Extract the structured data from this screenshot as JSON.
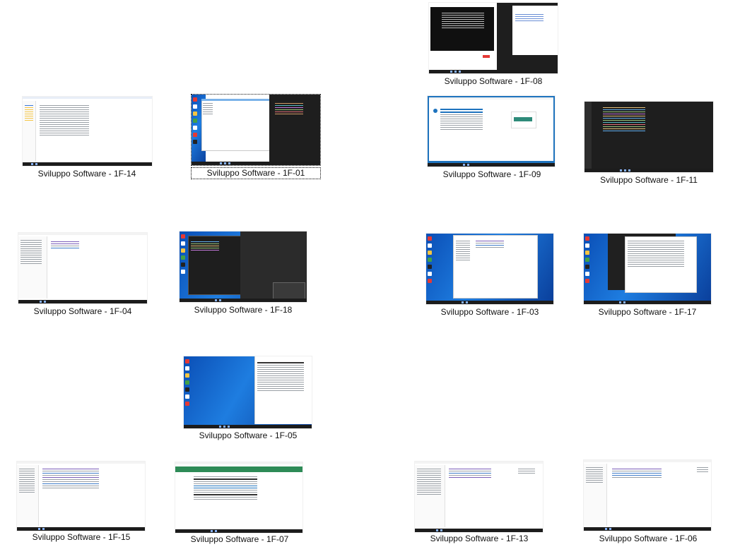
{
  "window": {
    "title": "Sviluppo Software"
  },
  "thumbnails": [
    {
      "id": "1F-08",
      "label": "Sviluppo Software - 1F-08",
      "style": "split-dark"
    },
    {
      "id": "1F-14",
      "label": "Sviluppo Software - 1F-14",
      "style": "explorer"
    },
    {
      "id": "1F-01",
      "label": "Sviluppo Software - 1F-01",
      "style": "blue-desktop-dark-editor"
    },
    {
      "id": "1F-09",
      "label": "Sviluppo Software - 1F-09",
      "style": "web-form"
    },
    {
      "id": "1F-11",
      "label": "Sviluppo Software - 1F-11",
      "style": "dark-editor"
    },
    {
      "id": "1F-04",
      "label": "Sviluppo Software - 1F-04",
      "style": "ide-light"
    },
    {
      "id": "1F-18",
      "label": "Sviluppo Software - 1F-18",
      "style": "blue-desktop-dark-editor"
    },
    {
      "id": "1F-03",
      "label": "Sviluppo Software - 1F-03",
      "style": "blue-desktop-ide"
    },
    {
      "id": "1F-17",
      "label": "Sviluppo Software - 1F-17",
      "style": "blue-desktop-doc"
    },
    {
      "id": "1F-05",
      "label": "Sviluppo Software - 1F-05",
      "style": "blue-desktop-doc-right"
    },
    {
      "id": "1F-15",
      "label": "Sviluppo Software - 1F-15",
      "style": "ide-light"
    },
    {
      "id": "1F-07",
      "label": "Sviluppo Software - 1F-07",
      "style": "web-green"
    },
    {
      "id": "1F-13",
      "label": "Sviluppo Software - 1F-13",
      "style": "ide-light"
    },
    {
      "id": "1F-06",
      "label": "Sviluppo Software - 1F-06",
      "style": "ide-light"
    }
  ],
  "selected": "1F-01",
  "colors": {
    "desktop_blue": "#0b5cd6",
    "editor_dark": "#1e1e1e",
    "taskbar": "#1c1c1c",
    "web_green": "#2e8b57",
    "web_blue": "#1e73be"
  }
}
